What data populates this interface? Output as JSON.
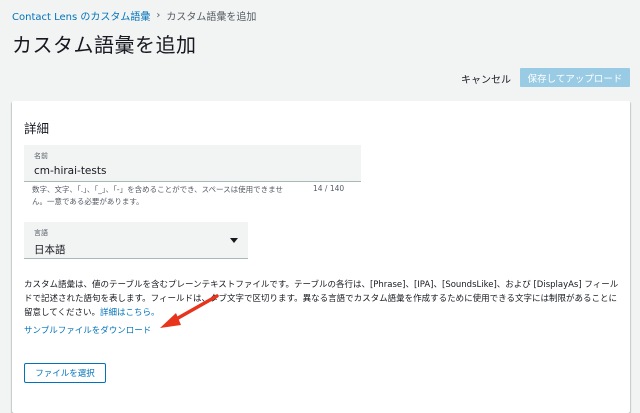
{
  "breadcrumb": {
    "parent": "Contact Lens のカスタム語彙",
    "separator": "›",
    "current": "カスタム語彙を追加"
  },
  "page_title": "カスタム語彙を追加",
  "actions": {
    "cancel_label": "キャンセル",
    "save_label": "保存してアップロード"
  },
  "panel": {
    "title": "詳細",
    "name_field": {
      "label": "名前",
      "value": "cm-hirai-tests",
      "hint": "数字、文字、「.」、「_」、「-」を含めることができ、スペースは使用できません。一意である必要があります。",
      "count": "14 / 140"
    },
    "language_field": {
      "label": "言語",
      "value": "日本語"
    },
    "description": "カスタム語彙は、値のテーブルを含むプレーンテキストファイルです。テーブルの各行は、[Phrase]、[IPA]、[SoundsLike]、および [DisplayAs] フィールドで記述された語句を表します。フィールドは、タブ文字で区切ります。異なる言語でカスタム語彙を作成するために使用できる文字には制限があることに留意してください。",
    "details_link": "詳細はこちら。",
    "download_link": "サンプルファイルをダウンロード",
    "choose_file_label": "ファイルを選択"
  },
  "colors": {
    "link": "#0073bb",
    "primary_disabled": "#99cbe4",
    "annotation_arrow": "#e8341c",
    "background": "#f2f3f3"
  }
}
